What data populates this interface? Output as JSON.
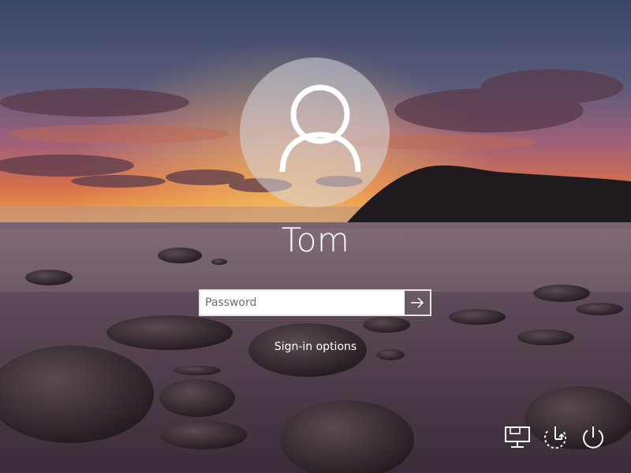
{
  "user": {
    "name": "Tom"
  },
  "password": {
    "placeholder": "Password",
    "value": ""
  },
  "submit": {
    "icon": "arrow-right-icon"
  },
  "sign_in_options": {
    "label": "Sign-in options"
  },
  "corner_icons": {
    "network": "network-icon",
    "accessibility": "ease-of-access-icon",
    "power": "power-icon"
  },
  "colors": {
    "text": "#ffffff",
    "input_background": "#ffffff",
    "submit_background": "#6e5f69",
    "avatar_circle": "#d7d7dc"
  }
}
